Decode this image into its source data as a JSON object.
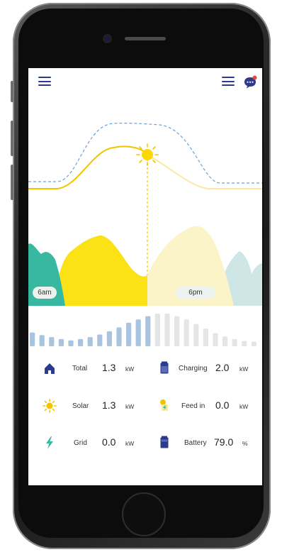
{
  "header": {
    "menu_icon": "hamburger-menu-icon",
    "list_icon": "list-menu-icon",
    "chat_icon": "chat-bubble-icon",
    "accent_color": "#2b3a8c",
    "notification_color": "#e8453c"
  },
  "chart_data": {
    "type": "area",
    "x_labels": [
      "6am",
      "6pm"
    ],
    "series_colors": {
      "solar_curve": "#f2c400",
      "forecast_curve": "#6aa0d8",
      "morning_teal": "#38b8a0",
      "day_yellow": "#fbe217",
      "evening_cream": "#fbf4c8",
      "night_blue": "#cfe6e6",
      "bars_active": "#a9c4de",
      "bars_future": "#e4e6e6"
    },
    "bar_levels": [
      0.42,
      0.34,
      0.28,
      0.22,
      0.18,
      0.22,
      0.28,
      0.36,
      0.46,
      0.58,
      0.72,
      0.82,
      0.92,
      1.0,
      1.0,
      0.92,
      0.82,
      0.68,
      0.54,
      0.4,
      0.3,
      0.22,
      0.16,
      0.14
    ],
    "current_index": 13
  },
  "stats": [
    {
      "left": {
        "icon": "home-icon",
        "label": "Total",
        "value": "1.3",
        "unit": "kW"
      },
      "right": {
        "icon": "battery-charging-icon",
        "label": "Charging",
        "value": "2.0",
        "unit": "kW"
      }
    },
    {
      "left": {
        "icon": "sun-icon",
        "label": "Solar",
        "value": "1.3",
        "unit": "kW"
      },
      "right": {
        "icon": "feed-in-icon",
        "label": "Feed in",
        "value": "0.0",
        "unit": "kW"
      }
    },
    {
      "left": {
        "icon": "lightning-icon",
        "label": "Grid",
        "value": "0.0",
        "unit": "kW"
      },
      "right": {
        "icon": "battery-icon",
        "label": "Battery",
        "value": "79.0",
        "unit": "%"
      }
    }
  ]
}
